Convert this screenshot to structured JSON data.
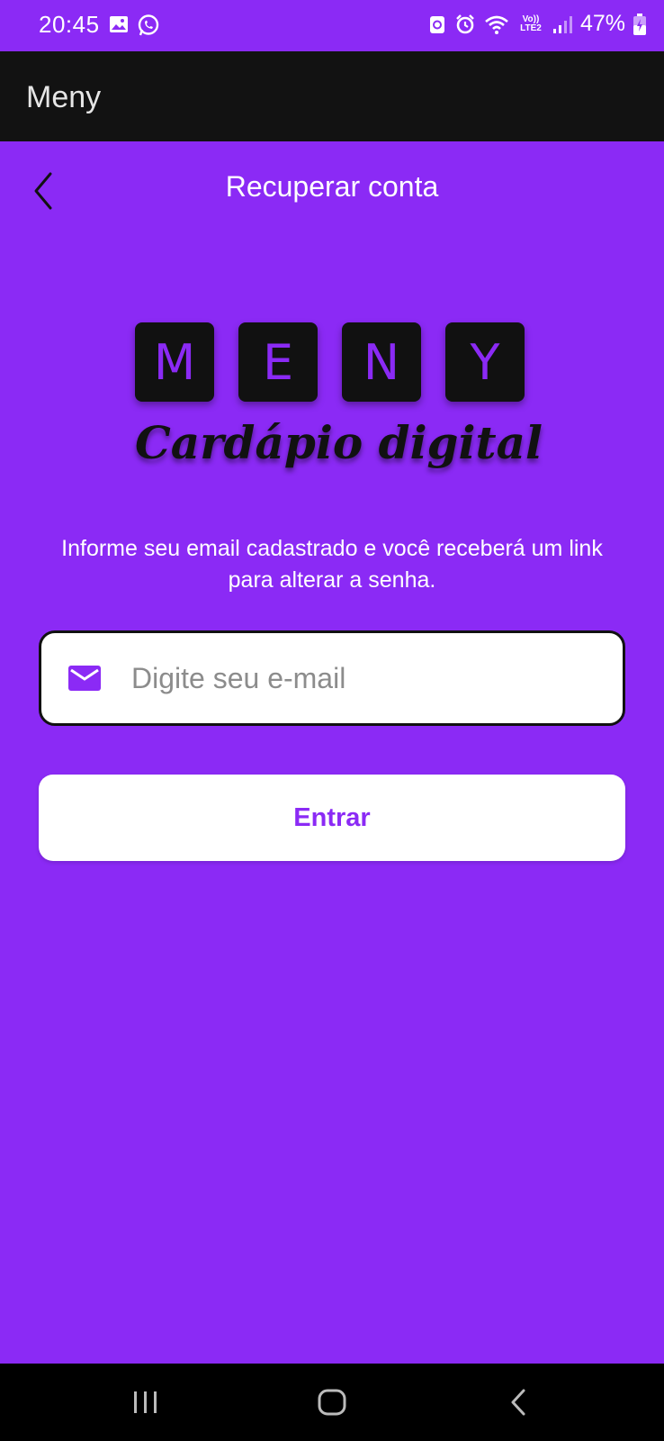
{
  "status_bar": {
    "time": "20:45",
    "battery": "47%",
    "network": "Vo)) LTE2",
    "icons": [
      "gallery-icon",
      "whatsapp-icon",
      "data-saver-icon",
      "alarm-icon",
      "wifi-icon",
      "signal-icon",
      "battery-icon"
    ]
  },
  "app_bar": {
    "title": "Meny"
  },
  "header": {
    "title": "Recuperar conta",
    "back_icon": "chevron-left-icon"
  },
  "logo": {
    "letters": [
      "M",
      "E",
      "N",
      "Y"
    ],
    "subtitle": "Cardápio digital"
  },
  "info_text": "Informe seu email cadastrado e você receberá um link para alterar a senha.",
  "email_field": {
    "placeholder": "Digite seu e-mail",
    "value": "",
    "icon": "mail-icon"
  },
  "submit_button": {
    "label": "Entrar"
  },
  "nav_bar": {
    "items": [
      "recent-apps-icon",
      "home-icon",
      "back-icon"
    ]
  },
  "colors": {
    "primary": "#8b2af5",
    "app_bar": "#121212",
    "tile": "#111111",
    "nav": "#000000"
  }
}
